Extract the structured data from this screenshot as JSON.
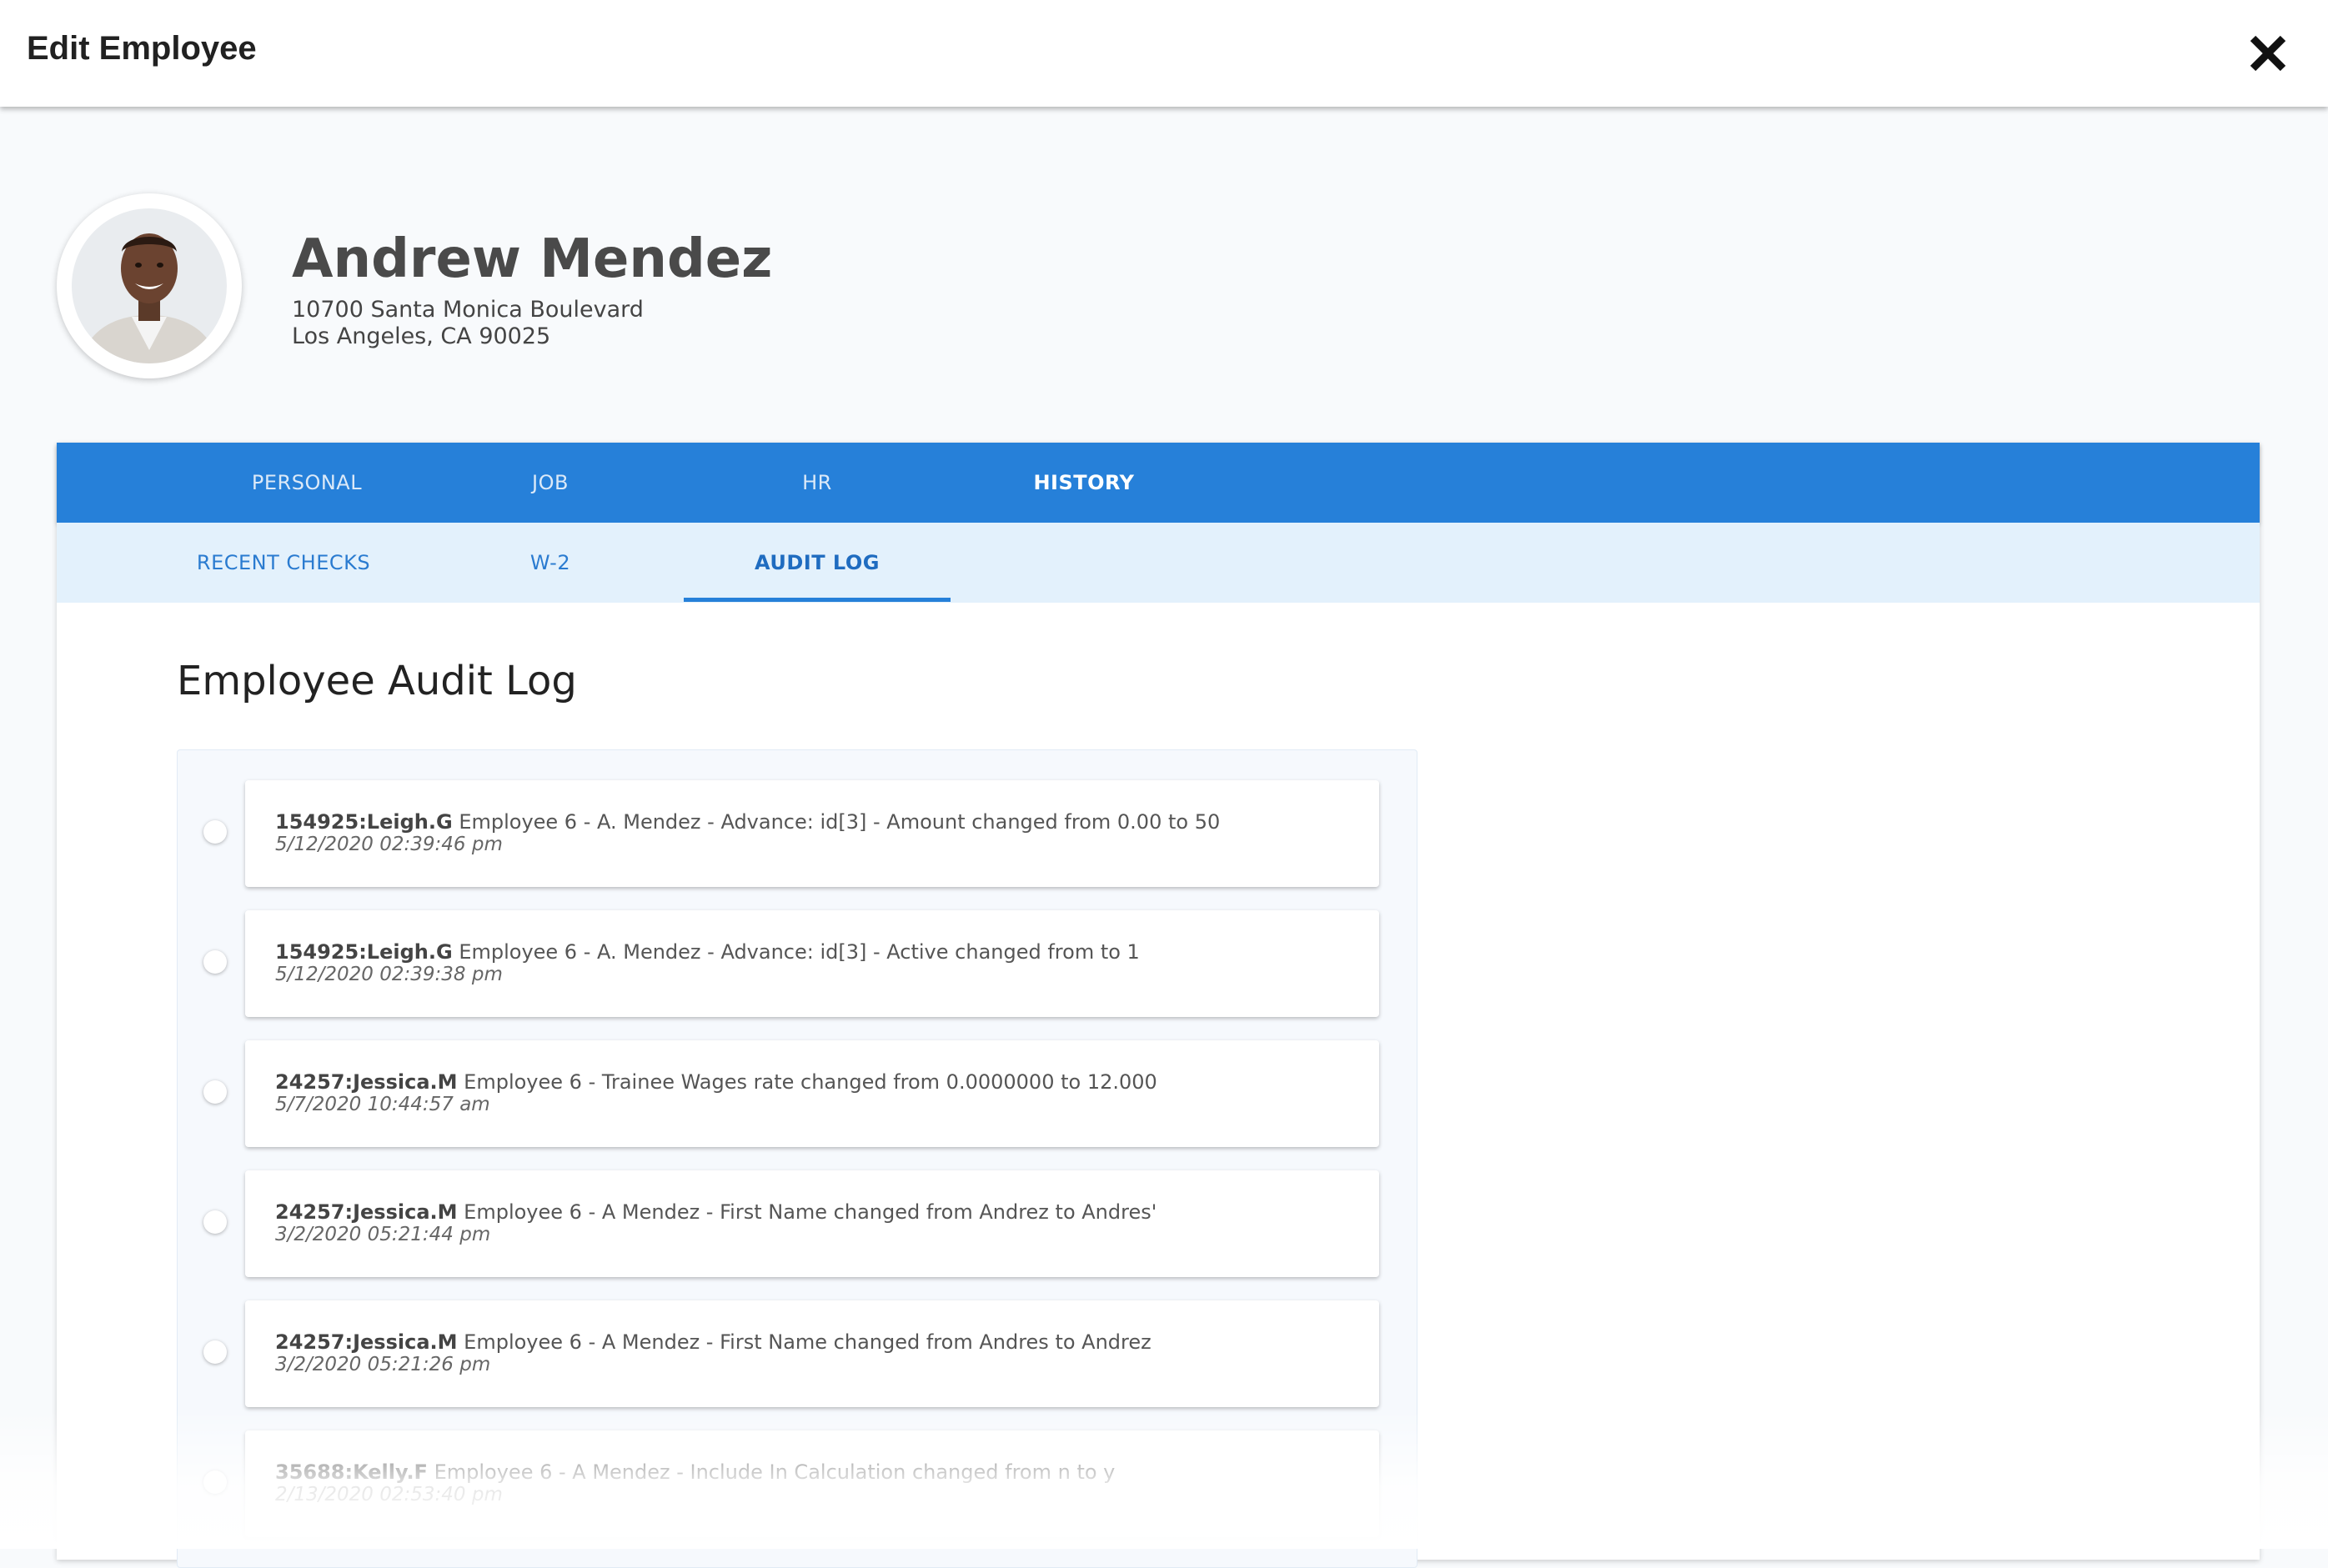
{
  "header": {
    "title": "Edit Employee",
    "close_icon": "close-icon"
  },
  "employee": {
    "name": "Andrew Mendez",
    "address_line1": "10700 Santa Monica Boulevard",
    "address_line2": "Los Angeles, CA 90025"
  },
  "tabs": {
    "main": [
      "PERSONAL",
      "JOB",
      "HR",
      "HISTORY"
    ],
    "main_active": "HISTORY",
    "sub": [
      "RECENT CHECKS",
      "W-2",
      "AUDIT LOG"
    ],
    "sub_active": "AUDIT LOG"
  },
  "audit": {
    "title": "Employee Audit Log",
    "entries": [
      {
        "user": "154925:Leigh.G",
        "message": "Employee 6 - A. Mendez - Advance: id[3] - Amount changed from 0.00 to 50",
        "date": "5/12/2020 02:39:46 pm"
      },
      {
        "user": "154925:Leigh.G",
        "message": "Employee 6 - A. Mendez - Advance: id[3] - Active changed from to 1",
        "date": "5/12/2020 02:39:38 pm"
      },
      {
        "user": "24257:Jessica.M",
        "message": "Employee 6 - Trainee Wages rate changed from 0.0000000 to 12.000",
        "date": "5/7/2020 10:44:57 am"
      },
      {
        "user": "24257:Jessica.M",
        "message": "Employee 6 - A Mendez - First Name changed from Andrez to Andres'",
        "date": "3/2/2020 05:21:44 pm"
      },
      {
        "user": "24257:Jessica.M",
        "message": "Employee 6 - A Mendez - First Name changed from Andres to Andrez",
        "date": "3/2/2020 05:21:26 pm"
      },
      {
        "user": "35688:Kelly.F",
        "message": "Employee 6 - A Mendez - Include In Calculation changed from n to y",
        "date": "2/13/2020 02:53:40 pm"
      }
    ]
  },
  "colors": {
    "primary": "#2680d9",
    "sub_tab_bg": "#e3f1fc",
    "page_bg": "#f8fafc"
  }
}
